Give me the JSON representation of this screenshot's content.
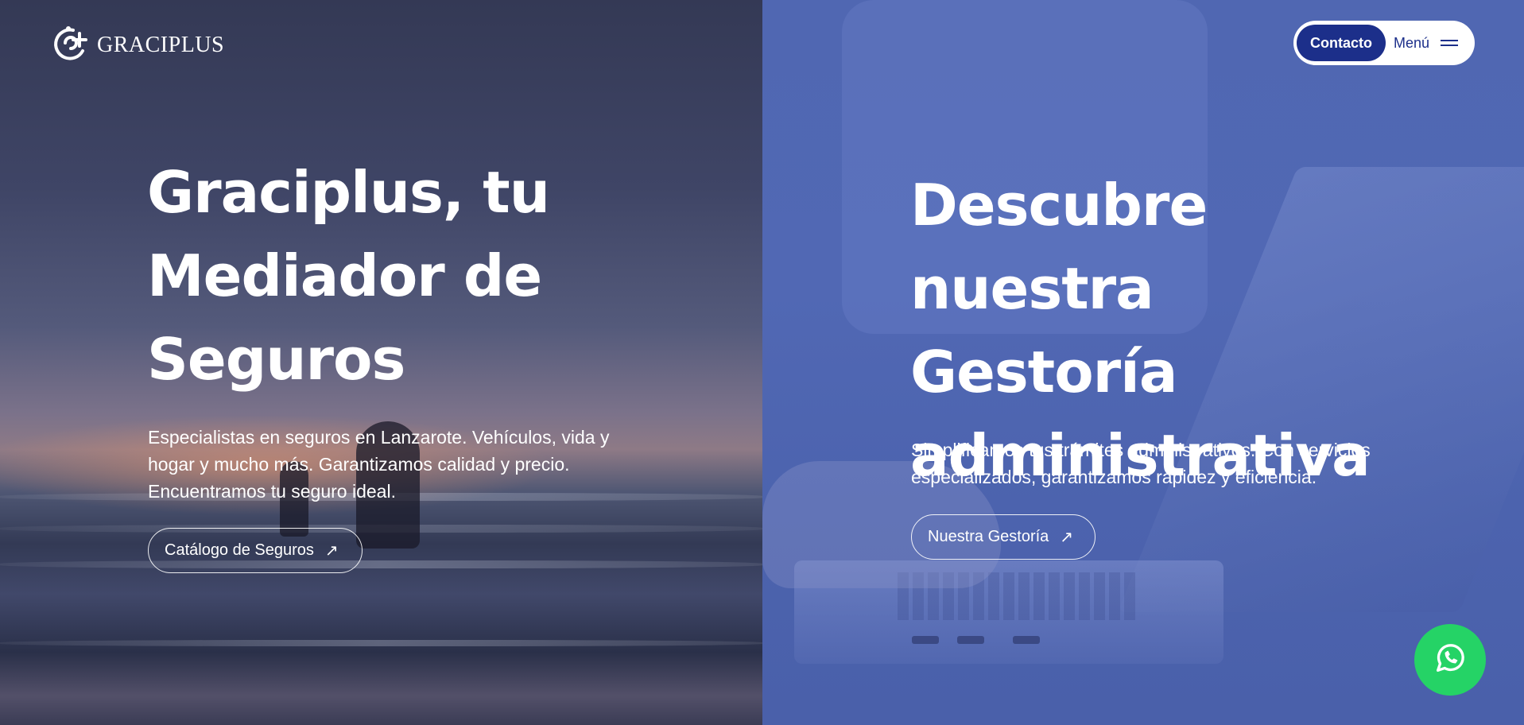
{
  "brand": {
    "name": "GRACIPLUS"
  },
  "nav": {
    "contact_label": "Contacto",
    "menu_label": "Menú"
  },
  "hero_left": {
    "title_line1": "Graciplus, tu",
    "title_line2": "Mediador de",
    "title_line3": "Seguros",
    "description": "Especialistas en seguros en Lanzarote. Vehículos, vida y hogar y mucho más. Garantizamos calidad y precio. Encuentramos tu seguro ideal.",
    "cta_label": "Catálogo de Seguros"
  },
  "hero_right": {
    "title_line1": "Descubre nuestra",
    "title_line2": "Gestoría",
    "title_line3": "administrativa",
    "description": "Simplificamos tus trámites administrativos. Con servicios especializados, garantizamos rapidez y eficiencia.",
    "cta_label": "Nuestra Gestoría"
  },
  "icons": {
    "logo": "graciplus-logo-icon",
    "menu": "hamburger-icon",
    "cta_arrow": "arrow-up-right-icon",
    "whatsapp": "whatsapp-icon"
  },
  "colors": {
    "brand_navy": "#1c2f8a",
    "overlay_blue": "#5067b2",
    "whatsapp_green": "#25d366"
  }
}
